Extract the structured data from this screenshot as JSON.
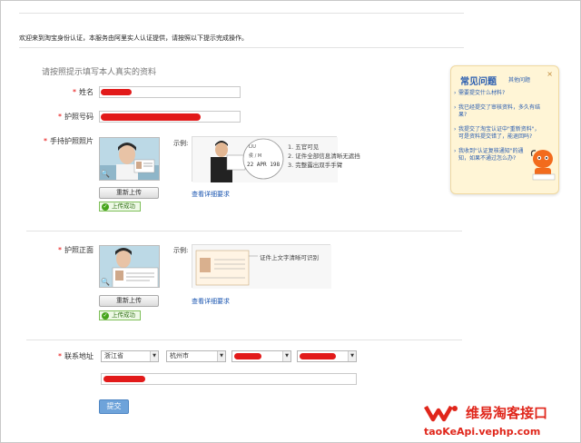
{
  "intro": "欢迎来到淘宝身份认证，本服务由阿里实人认证提供，请按照以下提示完成操作。",
  "subtitle": "请按照提示填写本人真实的资料",
  "fields": {
    "name_label": "姓名",
    "passport_no_label": "护照号码",
    "hold_passport_label": "手持护照照片",
    "passport_front_label": "护照正面",
    "address_label": "联系地址"
  },
  "upload_hold": {
    "reupload": "重新上传",
    "success": "上传成功",
    "sample_label": "示例:",
    "view_requirements": "查看详细要求",
    "sample_tips": [
      "1. 五官可见",
      "2. 证件全部信息清晰无遮挡",
      "3. 完整露出双手手臂"
    ]
  },
  "upload_front": {
    "reupload": "重新上传",
    "success": "上传成功",
    "sample_label": "示例:",
    "view_requirements": "查看详细要求",
    "sample_tip": "证件上文字清晰可识别"
  },
  "address": {
    "province": "浙江省",
    "city": "杭州市"
  },
  "submit_label": "提交",
  "faq": {
    "title": "常见问题",
    "more": "其他问题",
    "items": [
      "需要提交什么材料?",
      "我已经提交了审核资料，多久有结果?",
      "我提交了淘宝认证中\"重新资料\"，可是资料提交错了，能退回吗?",
      "我收到\"认证复核通知\"的通知，如果不通过怎么办?"
    ]
  },
  "watermark": {
    "brand": "维易淘客接口",
    "url": "taoKeApi.vephp.com"
  },
  "colors": {
    "required_star": "#e60000",
    "link": "#1a55b0",
    "submit_bg": "#6ea3da",
    "redaction": "#e21a1a",
    "watermark": "#e0261b"
  }
}
